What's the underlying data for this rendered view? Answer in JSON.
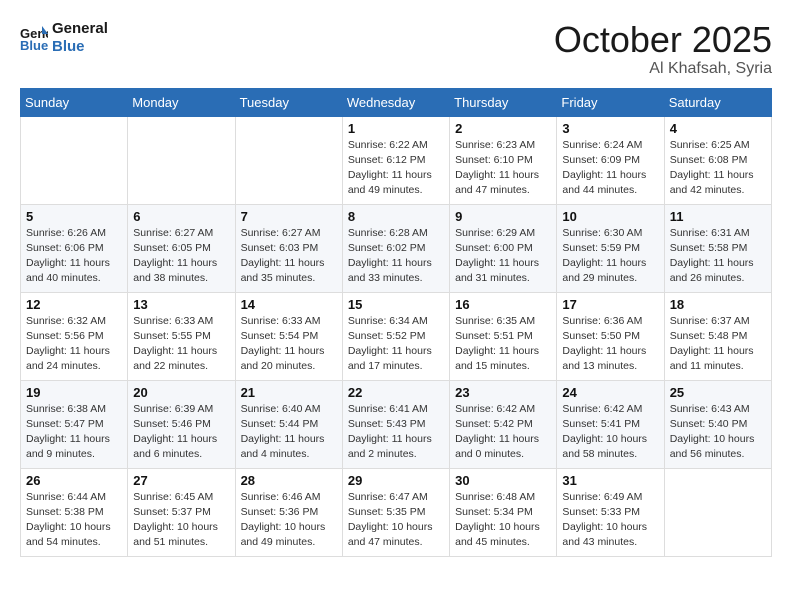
{
  "header": {
    "logo_line1": "General",
    "logo_line2": "Blue",
    "month": "October 2025",
    "location": "Al Khafsah, Syria"
  },
  "weekdays": [
    "Sunday",
    "Monday",
    "Tuesday",
    "Wednesday",
    "Thursday",
    "Friday",
    "Saturday"
  ],
  "weeks": [
    [
      {
        "day": "",
        "info": ""
      },
      {
        "day": "",
        "info": ""
      },
      {
        "day": "",
        "info": ""
      },
      {
        "day": "1",
        "info": "Sunrise: 6:22 AM\nSunset: 6:12 PM\nDaylight: 11 hours\nand 49 minutes."
      },
      {
        "day": "2",
        "info": "Sunrise: 6:23 AM\nSunset: 6:10 PM\nDaylight: 11 hours\nand 47 minutes."
      },
      {
        "day": "3",
        "info": "Sunrise: 6:24 AM\nSunset: 6:09 PM\nDaylight: 11 hours\nand 44 minutes."
      },
      {
        "day": "4",
        "info": "Sunrise: 6:25 AM\nSunset: 6:08 PM\nDaylight: 11 hours\nand 42 minutes."
      }
    ],
    [
      {
        "day": "5",
        "info": "Sunrise: 6:26 AM\nSunset: 6:06 PM\nDaylight: 11 hours\nand 40 minutes."
      },
      {
        "day": "6",
        "info": "Sunrise: 6:27 AM\nSunset: 6:05 PM\nDaylight: 11 hours\nand 38 minutes."
      },
      {
        "day": "7",
        "info": "Sunrise: 6:27 AM\nSunset: 6:03 PM\nDaylight: 11 hours\nand 35 minutes."
      },
      {
        "day": "8",
        "info": "Sunrise: 6:28 AM\nSunset: 6:02 PM\nDaylight: 11 hours\nand 33 minutes."
      },
      {
        "day": "9",
        "info": "Sunrise: 6:29 AM\nSunset: 6:00 PM\nDaylight: 11 hours\nand 31 minutes."
      },
      {
        "day": "10",
        "info": "Sunrise: 6:30 AM\nSunset: 5:59 PM\nDaylight: 11 hours\nand 29 minutes."
      },
      {
        "day": "11",
        "info": "Sunrise: 6:31 AM\nSunset: 5:58 PM\nDaylight: 11 hours\nand 26 minutes."
      }
    ],
    [
      {
        "day": "12",
        "info": "Sunrise: 6:32 AM\nSunset: 5:56 PM\nDaylight: 11 hours\nand 24 minutes."
      },
      {
        "day": "13",
        "info": "Sunrise: 6:33 AM\nSunset: 5:55 PM\nDaylight: 11 hours\nand 22 minutes."
      },
      {
        "day": "14",
        "info": "Sunrise: 6:33 AM\nSunset: 5:54 PM\nDaylight: 11 hours\nand 20 minutes."
      },
      {
        "day": "15",
        "info": "Sunrise: 6:34 AM\nSunset: 5:52 PM\nDaylight: 11 hours\nand 17 minutes."
      },
      {
        "day": "16",
        "info": "Sunrise: 6:35 AM\nSunset: 5:51 PM\nDaylight: 11 hours\nand 15 minutes."
      },
      {
        "day": "17",
        "info": "Sunrise: 6:36 AM\nSunset: 5:50 PM\nDaylight: 11 hours\nand 13 minutes."
      },
      {
        "day": "18",
        "info": "Sunrise: 6:37 AM\nSunset: 5:48 PM\nDaylight: 11 hours\nand 11 minutes."
      }
    ],
    [
      {
        "day": "19",
        "info": "Sunrise: 6:38 AM\nSunset: 5:47 PM\nDaylight: 11 hours\nand 9 minutes."
      },
      {
        "day": "20",
        "info": "Sunrise: 6:39 AM\nSunset: 5:46 PM\nDaylight: 11 hours\nand 6 minutes."
      },
      {
        "day": "21",
        "info": "Sunrise: 6:40 AM\nSunset: 5:44 PM\nDaylight: 11 hours\nand 4 minutes."
      },
      {
        "day": "22",
        "info": "Sunrise: 6:41 AM\nSunset: 5:43 PM\nDaylight: 11 hours\nand 2 minutes."
      },
      {
        "day": "23",
        "info": "Sunrise: 6:42 AM\nSunset: 5:42 PM\nDaylight: 11 hours\nand 0 minutes."
      },
      {
        "day": "24",
        "info": "Sunrise: 6:42 AM\nSunset: 5:41 PM\nDaylight: 10 hours\nand 58 minutes."
      },
      {
        "day": "25",
        "info": "Sunrise: 6:43 AM\nSunset: 5:40 PM\nDaylight: 10 hours\nand 56 minutes."
      }
    ],
    [
      {
        "day": "26",
        "info": "Sunrise: 6:44 AM\nSunset: 5:38 PM\nDaylight: 10 hours\nand 54 minutes."
      },
      {
        "day": "27",
        "info": "Sunrise: 6:45 AM\nSunset: 5:37 PM\nDaylight: 10 hours\nand 51 minutes."
      },
      {
        "day": "28",
        "info": "Sunrise: 6:46 AM\nSunset: 5:36 PM\nDaylight: 10 hours\nand 49 minutes."
      },
      {
        "day": "29",
        "info": "Sunrise: 6:47 AM\nSunset: 5:35 PM\nDaylight: 10 hours\nand 47 minutes."
      },
      {
        "day": "30",
        "info": "Sunrise: 6:48 AM\nSunset: 5:34 PM\nDaylight: 10 hours\nand 45 minutes."
      },
      {
        "day": "31",
        "info": "Sunrise: 6:49 AM\nSunset: 5:33 PM\nDaylight: 10 hours\nand 43 minutes."
      },
      {
        "day": "",
        "info": ""
      }
    ]
  ]
}
